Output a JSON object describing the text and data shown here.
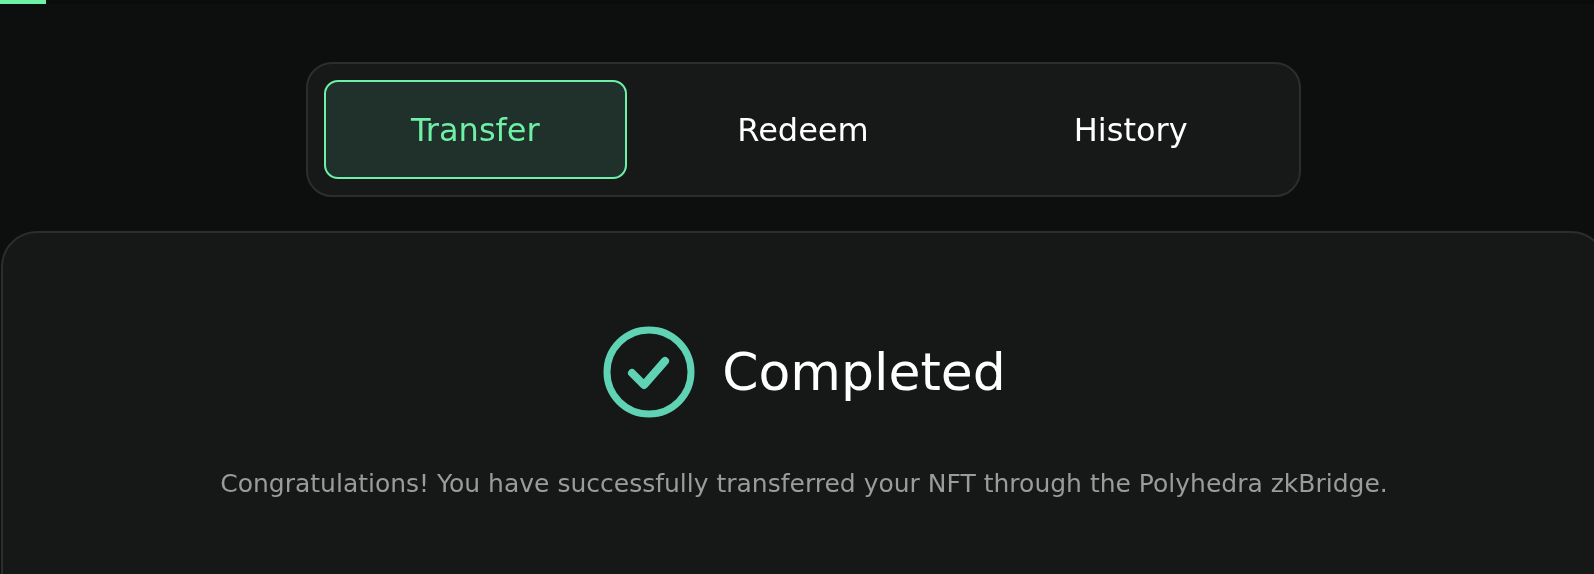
{
  "progress": {
    "level": 0.029
  },
  "tabs": [
    {
      "label": "Transfer",
      "selected": true
    },
    {
      "label": "Redeem",
      "selected": false
    },
    {
      "label": "History",
      "selected": false
    }
  ],
  "status": {
    "kind": "completed",
    "title": "Completed",
    "message": "Congratulations! You have successfully transferred your NFT through the Polyhedra zkBridge."
  }
}
